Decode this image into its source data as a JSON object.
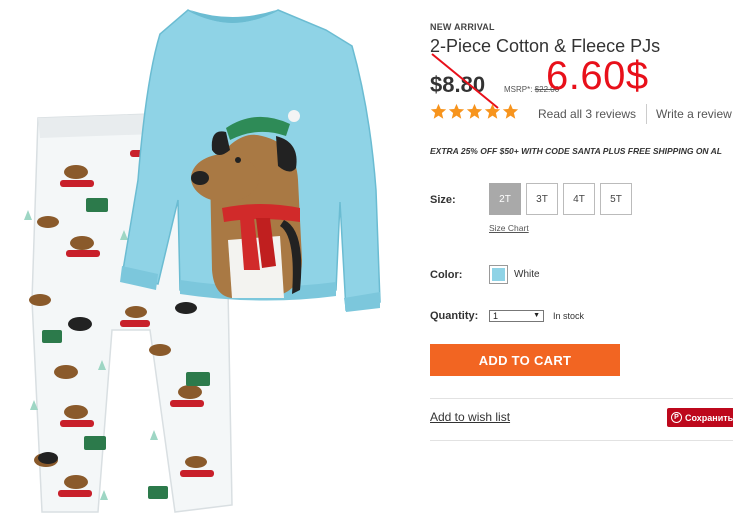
{
  "product": {
    "badge": "NEW ARRIVAL",
    "title": "2-Piece Cotton & Fleece PJs",
    "price": "$8.80",
    "msrp_label": "MSRP*:",
    "msrp_value": "$22.00",
    "overlay_price": "6.60$",
    "rating": 5,
    "reviews_link": "Read all 3 reviews",
    "write_review": "Write a review",
    "promo": "EXTRA 25% OFF $50+ WITH CODE SANTA PLUS FREE SHIPPING ON AL"
  },
  "size": {
    "label": "Size:",
    "options": [
      "2T",
      "3T",
      "4T",
      "5T"
    ],
    "selected": "2T",
    "chart_link": "Size Chart"
  },
  "color": {
    "label": "Color:",
    "name": "White",
    "swatch": "#8fd3e6"
  },
  "quantity": {
    "label": "Quantity:",
    "value": "1",
    "stock": "In stock"
  },
  "actions": {
    "add_to_cart": "ADD TO CART",
    "wishlist": "Add to wish list",
    "save": "Сохранить"
  },
  "colors": {
    "accent": "#f26522",
    "overlay_red": "#e8101a",
    "star": "#f7941d",
    "pinterest": "#bd081c",
    "shirt": "#8fd3e6"
  },
  "icons": {
    "star": "star-icon",
    "pinterest": "pinterest-icon",
    "dropdown": "dropdown-arrow-icon"
  }
}
